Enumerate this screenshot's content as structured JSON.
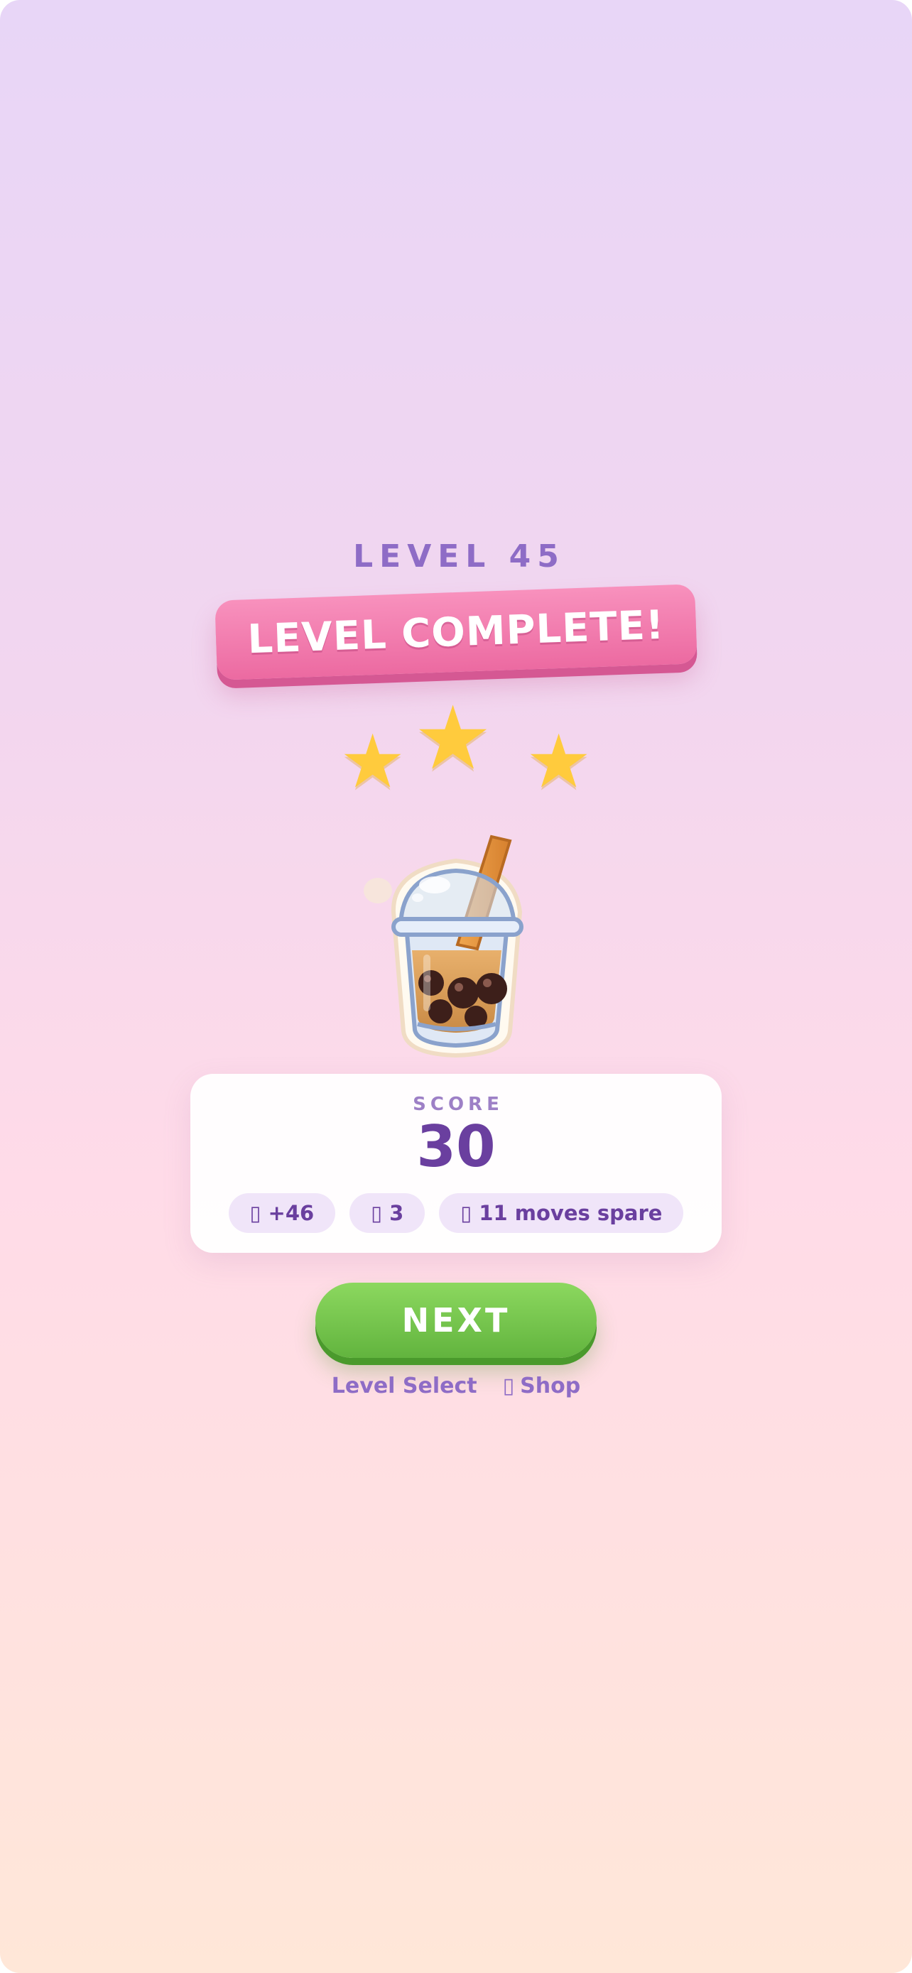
{
  "level": {
    "label": "LEVEL 45"
  },
  "banner": {
    "text": "LEVEL COMPLETE!"
  },
  "stars": {
    "earned": 3,
    "total": 3,
    "color": "#ffcb3d"
  },
  "mascot": {
    "icon": "bubble-tea-icon"
  },
  "score": {
    "label": "SCORE",
    "value": "30",
    "stats": [
      {
        "icon": "coin-icon",
        "text": "+46"
      },
      {
        "icon": "gem-icon",
        "text": "3"
      },
      {
        "icon": "moves-icon",
        "text": "11 moves spare"
      }
    ]
  },
  "actions": {
    "next_label": "NEXT",
    "level_select_label": "Level Select",
    "shop_label": "Shop",
    "shop_icon": "cart-icon"
  },
  "colors": {
    "accent_purple": "#6a3f9f",
    "banner_pink": "#ec6aa1",
    "next_green": "#62b43e"
  }
}
